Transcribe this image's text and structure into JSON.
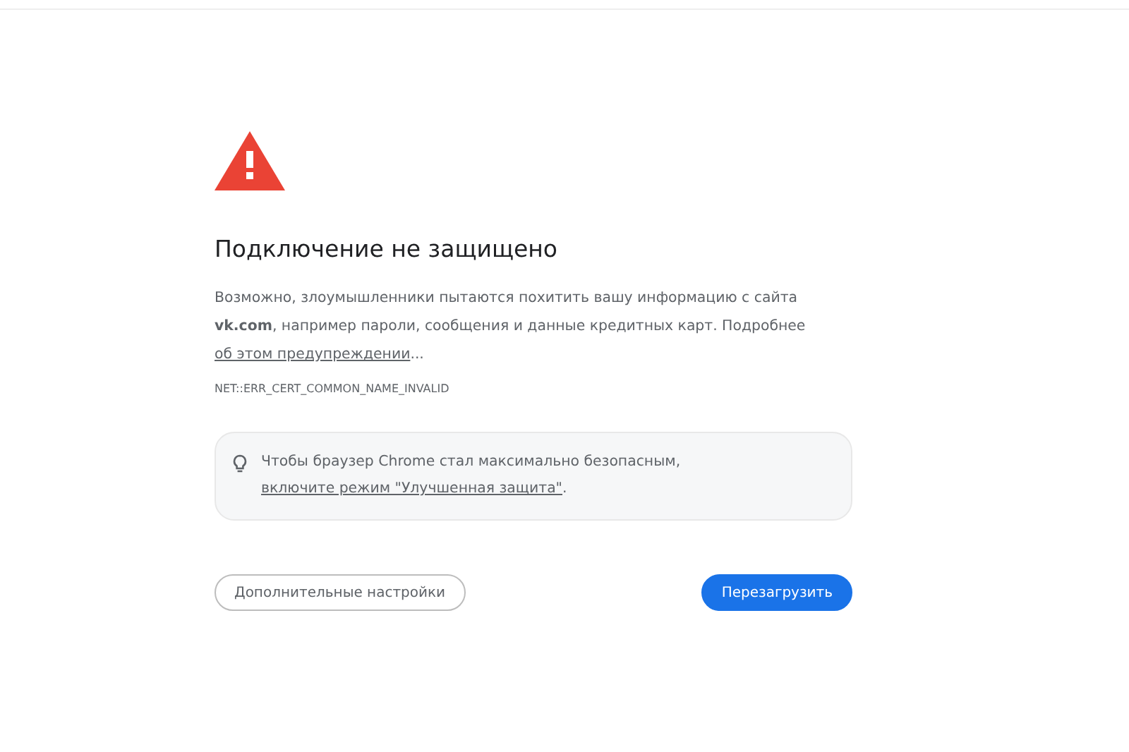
{
  "heading": "Подключение не защищено",
  "explanation": {
    "text": "Возможно, злоумышленники пытаются похитить вашу информацию с сайта **vk.com**, например пароли, сообщения и данные кредитных карт. Подробнее",
    "link": "об этом предупреждении",
    "after": "..."
  },
  "error_code": "NET::ERR_CERT_COMMON_NAME_INVALID",
  "tip": {
    "text": "Чтобы браузер Chrome стал максимально безопасным,",
    "link": "включите режим \"Улучшенная защита\"",
    "after": "."
  },
  "buttons": [
    {
      "label": "Дополнительные настройки",
      "kind": "secondary"
    },
    {
      "label": "Перезагрузить",
      "kind": "primary"
    }
  ]
}
